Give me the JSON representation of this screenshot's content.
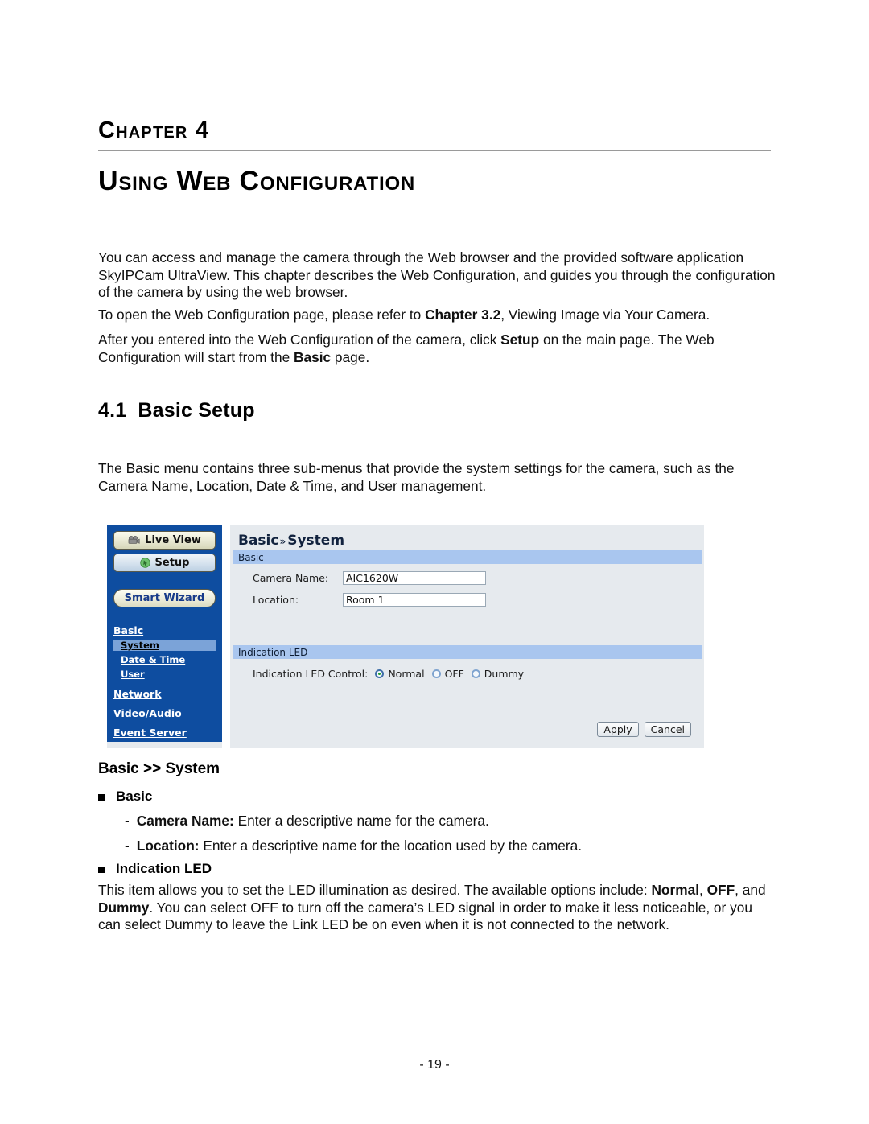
{
  "document": {
    "chapter_label": "Chapter 4",
    "chapter_title": "Using Web Configuration",
    "page_number": "- 19 -",
    "section": {
      "number": "4.1",
      "title": "Basic Setup"
    },
    "paragraphs": {
      "intro": "You can access and manage the camera through the Web browser and the provided software application SkyIPCam UltraView. This chapter describes the Web Configuration, and guides you through the configuration of the camera by using the web browser.",
      "open_page_prefix": "To open the Web Configuration page, please refer to ",
      "open_page_bold": "Chapter 3.2",
      "open_page_suffix": ", Viewing Image via Your Camera.",
      "after_entered_1": "After you entered into the Web Configuration of the camera, click ",
      "after_entered_bold_1": "Setup",
      "after_entered_2": " on the main page. The Web Configuration will start from the ",
      "after_entered_bold_2": "Basic",
      "after_entered_3": " page.",
      "basic_menu": "The Basic menu contains three sub-menus that provide the system settings for the camera, such as the Camera Name, Location, Date & Time, and User management.",
      "led_desc_1": "This item allows you to set the LED illumination as desired. The available options include: ",
      "led_desc_bold_1": "Normal",
      "led_desc_2": ", ",
      "led_desc_bold_2": "OFF",
      "led_desc_3": ", and ",
      "led_desc_bold_3": "Dummy",
      "led_desc_4": ". You can select OFF to turn off the camera’s LED signal in order to make it less noticeable, or you can select Dummy to leave the Link LED be on even when it is not connected to the network."
    },
    "explanations": {
      "heading": "Basic >> System",
      "bullet_basic": "Basic",
      "camera_name_term": "Camera Name:",
      "camera_name_desc": " Enter a descriptive name for the camera.",
      "location_term": "Location:",
      "location_desc": " Enter a descriptive name for the location used by the camera.",
      "bullet_led": "Indication LED"
    }
  },
  "screenshot": {
    "sidebar": {
      "live_view_button": "Live View",
      "live_view_icon": "camcorder-icon",
      "setup_button": "Setup",
      "setup_icon": "cursor-circle-icon",
      "smart_wizard_button": "Smart Wizard",
      "groups": [
        {
          "label": "Basic",
          "items": [
            {
              "label": "System",
              "active": true
            },
            {
              "label": "Date & Time",
              "active": false
            },
            {
              "label": "User",
              "active": false
            }
          ]
        },
        {
          "label": "Network",
          "items": []
        },
        {
          "label": "Video/Audio",
          "items": []
        },
        {
          "label": "Event Server",
          "items": []
        }
      ]
    },
    "content": {
      "breadcrumb_first": "Basic",
      "breadcrumb_sep": "»",
      "breadcrumb_second": "System",
      "section_basic": "Basic",
      "fields": [
        {
          "label": "Camera Name:",
          "value": "AIC1620W"
        },
        {
          "label": "Location:",
          "value": "Room 1"
        }
      ],
      "section_led": "Indication LED",
      "led_control_label": "Indication LED Control:",
      "led_options": [
        {
          "label": "Normal",
          "selected": true
        },
        {
          "label": "OFF",
          "selected": false
        },
        {
          "label": "Dummy",
          "selected": false
        }
      ],
      "apply_button": "Apply",
      "cancel_button": "Cancel"
    },
    "colors": {
      "sidebar_blue": "#0e4da0",
      "section_bar_blue": "#a9c6ef",
      "active_item_blue": "#7ba3d8",
      "content_bg": "#e6eaee",
      "radio_green": "#1f9e2a"
    }
  }
}
